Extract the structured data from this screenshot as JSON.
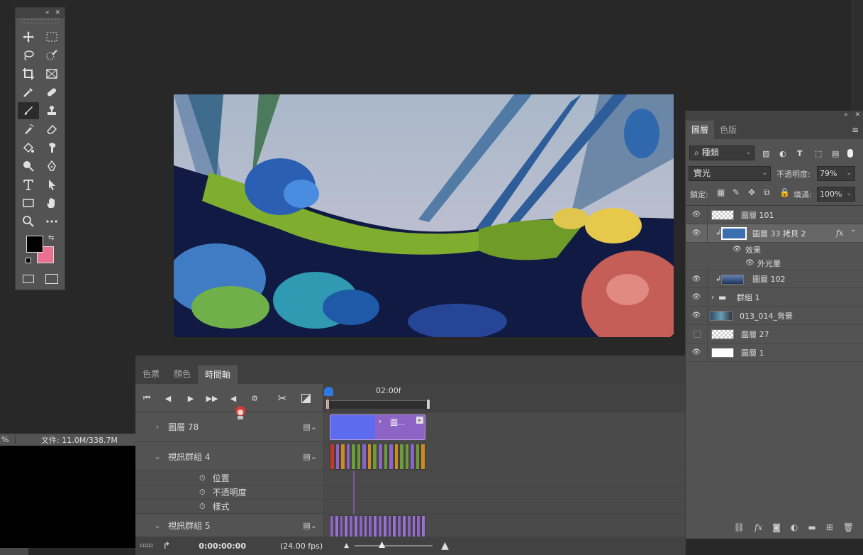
{
  "colors": {
    "foreground": "#000000",
    "background": "#e9708e",
    "accent": "#2d7ae6",
    "panel": "#535353"
  },
  "toolbox": {
    "collapse_icon": "double-chevron-left-icon",
    "close_icon": "close-icon",
    "tools": [
      "move-icon",
      "marquee-icon",
      "lasso-icon",
      "quick-select-icon",
      "crop-icon",
      "frame-icon",
      "eyedropper-icon",
      "healing-icon",
      "brush-icon",
      "stamp-icon",
      "history-brush-icon",
      "eraser-icon",
      "paint-bucket-icon",
      "smudge-icon",
      "dodge-icon",
      "pen-icon",
      "type-icon",
      "path-select-icon",
      "rectangle-icon",
      "hand-icon",
      "zoom-icon",
      "more-icon"
    ]
  },
  "status": {
    "zoom": "%",
    "file": "文件: 11.0M/338.7M"
  },
  "timeline": {
    "tabs": [
      "色票",
      "顏色",
      "時間軸"
    ],
    "ruler_label": "02:00f",
    "tracks": [
      {
        "name": "圖層 78",
        "clip_label": "圖..."
      },
      {
        "name": "視訊群組 4"
      },
      {
        "name": "位置"
      },
      {
        "name": "不透明度"
      },
      {
        "name": "樣式"
      },
      {
        "name": "視訊群組 5"
      }
    ],
    "timecode": "0:00:00:00",
    "fps": "(24.00 fps)"
  },
  "layers_panel": {
    "tabs": [
      "圖層",
      "色版"
    ],
    "filter": "種類",
    "blend_mode": "實光",
    "opacity_label": "不透明度:",
    "opacity_value": "79%",
    "lock_label": "鎖定:",
    "fill_label": "填滿:",
    "fill_value": "100%",
    "layers": [
      {
        "name": "圖層 101",
        "visible": true
      },
      {
        "name": "圖層 33 拷貝 2",
        "visible": true,
        "selected": true,
        "fx": "fx"
      },
      {
        "name": "效果",
        "visible": true,
        "effect": true
      },
      {
        "name": "外光暈",
        "visible": true,
        "effect": true
      },
      {
        "name": "圖層 102",
        "visible": true
      },
      {
        "name": "群組 1",
        "visible": true,
        "group": true
      },
      {
        "name": "013_014_背景",
        "visible": true
      },
      {
        "name": "圖層 27",
        "visible": false
      },
      {
        "name": "圖層 1",
        "visible": true
      }
    ]
  }
}
